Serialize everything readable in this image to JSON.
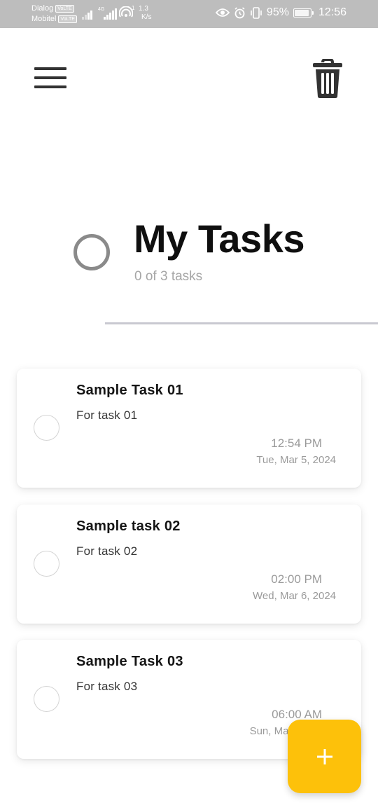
{
  "status_bar": {
    "carrier1": "Dialog",
    "carrier2": "Mobitel",
    "volte_badge": "VoLTE",
    "network_type": "4G",
    "speed_value": "1.3",
    "speed_unit": "K/s",
    "speed_sup": "1",
    "battery_percent": "95%",
    "battery_level": 0.95,
    "time": "12:56",
    "icons": [
      "signal-icon",
      "signal-icon",
      "hotspot-icon",
      "eye-icon",
      "alarm-icon",
      "vibrate-icon",
      "battery-icon"
    ]
  },
  "app_bar": {
    "menu_icon": "hamburger-menu-icon",
    "delete_icon": "trash-icon"
  },
  "header": {
    "title": "My Tasks",
    "subtitle": "0 of 3 tasks",
    "progress": 0
  },
  "tasks": [
    {
      "title": "Sample Task 01",
      "description": "For task 01",
      "time": "12:54 PM",
      "date": "Tue, Mar 5, 2024",
      "completed": false
    },
    {
      "title": "Sample task 02",
      "description": "For task 02",
      "time": "02:00 PM",
      "date": "Wed, Mar 6, 2024",
      "completed": false
    },
    {
      "title": "Sample Task 03",
      "description": "For task 03",
      "time": "06:00 AM",
      "date": "Sun, Mar 10, 2024",
      "completed": false
    }
  ],
  "fab": {
    "icon": "plus-icon"
  },
  "colors": {
    "accent": "#fdc10a",
    "status_bar": "#bdbdbd",
    "icon_dark": "#333333",
    "muted_text": "#9a9a9a"
  }
}
